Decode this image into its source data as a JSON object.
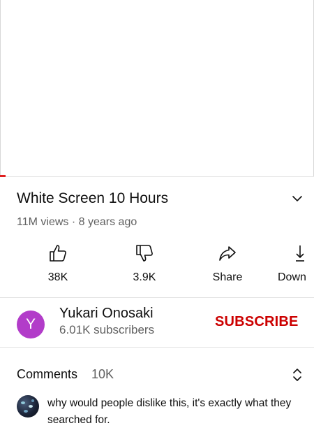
{
  "video": {
    "title": "White Screen 10 Hours",
    "views": "11M views",
    "separator": "·",
    "age": "8 years ago",
    "progress_color": "#e02020"
  },
  "actions": {
    "like": {
      "label": "38K",
      "icon": "thumbs-up-icon"
    },
    "dislike": {
      "label": "3.9K",
      "icon": "thumbs-down-icon"
    },
    "share": {
      "label": "Share",
      "icon": "share-arrow-icon"
    },
    "download": {
      "label": "Down",
      "icon": "download-icon"
    }
  },
  "channel": {
    "avatar_letter": "Y",
    "avatar_color": "#b23cc9",
    "name": "Yukari Onosaki",
    "subscribers": "6.01K subscribers",
    "subscribe_label": "SUBSCRIBE",
    "subscribe_color": "#cc0000"
  },
  "comments": {
    "title": "Comments",
    "count": "10K",
    "top_comment": {
      "text": "why would people dislike this, it's exactly what they searched for."
    }
  }
}
